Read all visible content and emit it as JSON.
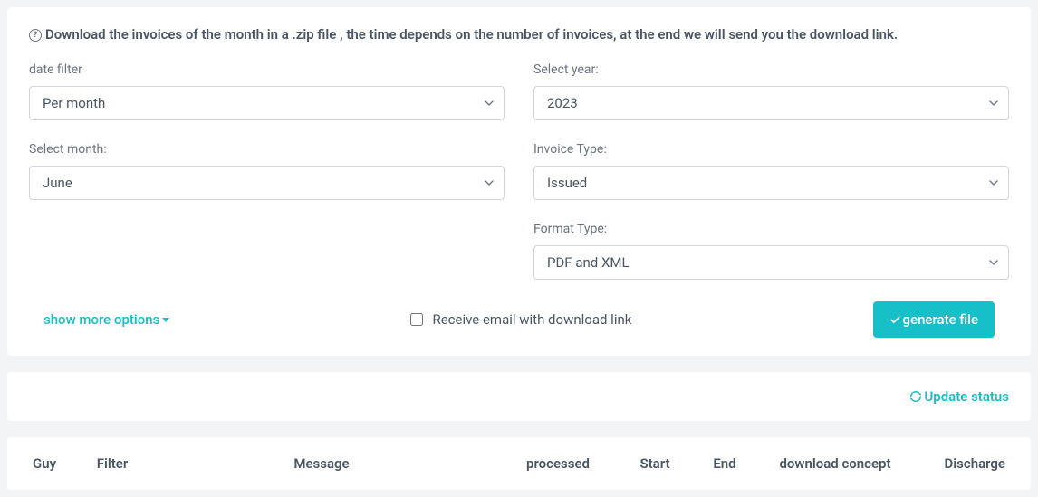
{
  "info": {
    "text": "Download the invoices of the month in a .zip file , the time depends on the number of invoices, at the end we will send you the download link."
  },
  "form": {
    "date_filter": {
      "label": "date filter",
      "value": "Per month"
    },
    "select_year": {
      "label": "Select year:",
      "value": "2023"
    },
    "select_month": {
      "label": "Select month:",
      "value": "June"
    },
    "invoice_type": {
      "label": "Invoice Type:",
      "value": "Issued"
    },
    "format_type": {
      "label": "Format Type:",
      "value": "PDF and XML"
    }
  },
  "actions": {
    "show_more": "show more options",
    "receive_email_label": "Receive email with download link",
    "generate_button": "generate file"
  },
  "status": {
    "update_label": "Update status"
  },
  "table": {
    "headers": {
      "guy": "Guy",
      "filter": "Filter",
      "message": "Message",
      "processed": "processed",
      "start": "Start",
      "end": "End",
      "download": "download concept",
      "discharge": "Discharge"
    }
  }
}
